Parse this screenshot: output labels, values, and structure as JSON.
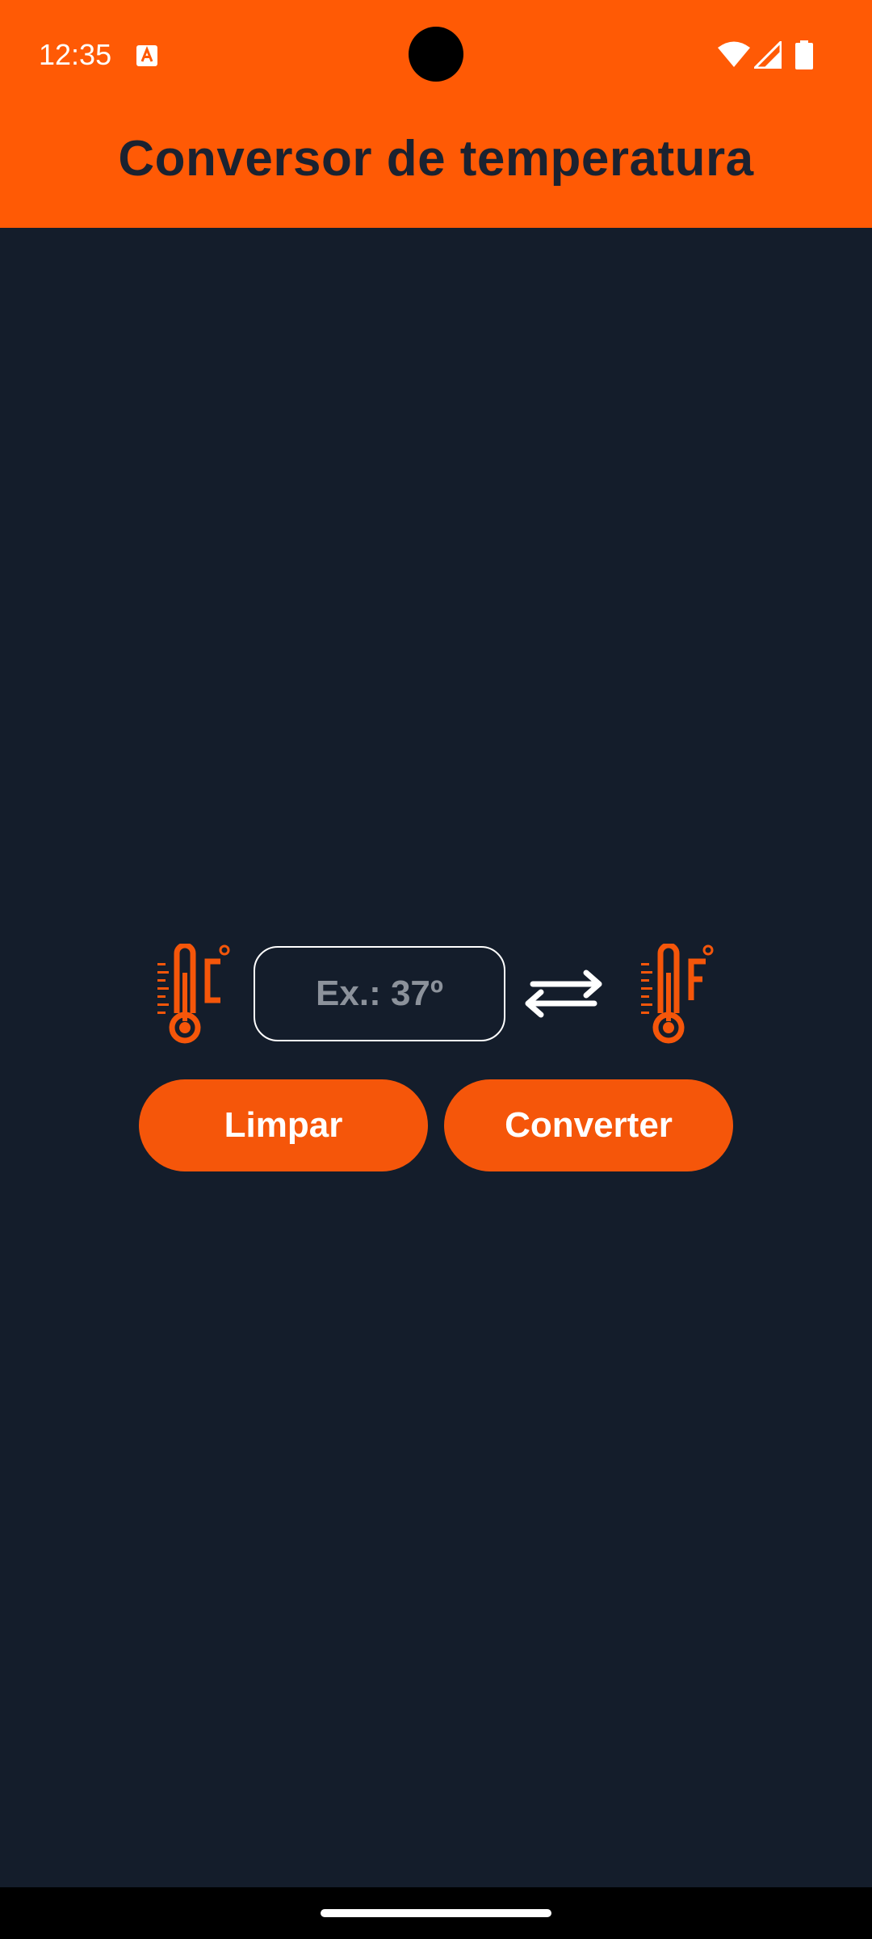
{
  "status_bar": {
    "time": "12:35",
    "notification_icon": "text-a-icon",
    "icons": [
      "wifi-icon",
      "signal-icon",
      "battery-icon"
    ]
  },
  "app_bar": {
    "title": "Conversor de temperatura"
  },
  "converter": {
    "from_icon": "thermometer-celsius-icon",
    "to_icon": "thermometer-fahrenheit-icon",
    "swap_icon": "swap-arrows-icon",
    "input_value": "",
    "input_placeholder": "Ex.: 37º"
  },
  "buttons": {
    "clear_label": "Limpar",
    "convert_label": "Converter"
  },
  "colors": {
    "accent": "#ff5a05",
    "background": "#141d2b",
    "title_text": "#1b2230",
    "button": "#f5560a"
  }
}
